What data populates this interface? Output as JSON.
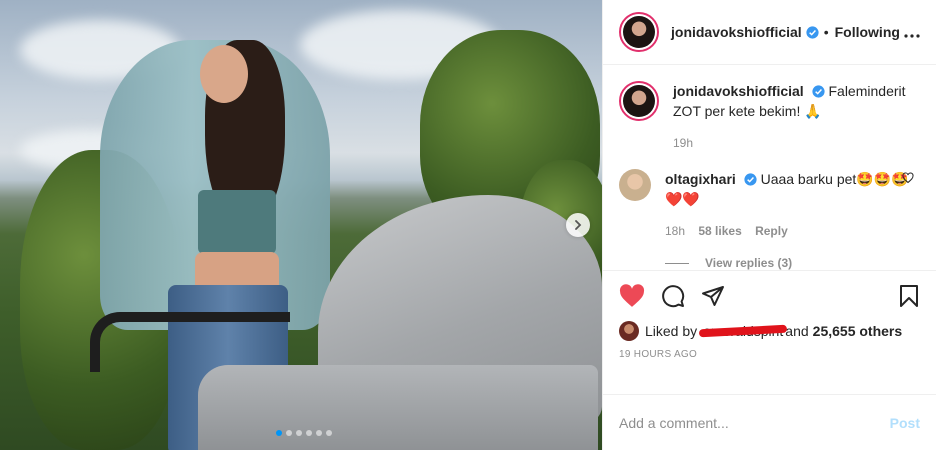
{
  "header": {
    "username": "jonidavokshiofficial",
    "separator": "•",
    "follow_state": "Following",
    "more_label": "•••"
  },
  "caption": {
    "username": "jonidavokshiofficial",
    "text": "Faleminderit ZOT per kete bekim! 🙏",
    "time": "19h"
  },
  "comments": [
    {
      "username": "oltagixhari",
      "text": "Uaaa barku pet🤩🤩🤩❤️❤️",
      "time": "18h",
      "likes": "58 likes",
      "reply_label": "Reply",
      "view_replies": "View replies (3)"
    }
  ],
  "likes": {
    "prefix": "Liked by",
    "name": "emeraldspirit",
    "suffix": "and",
    "others": "25,655 others"
  },
  "timestamp": "19 HOURS AGO",
  "add_comment": {
    "placeholder": "Add a comment...",
    "post_label": "Post"
  },
  "carousel": {
    "total_slides": 6,
    "active_index": 0
  },
  "colors": {
    "verified": "#3897f0",
    "like_red": "#ed4956",
    "post_button": "#b2dffc"
  },
  "icons": {
    "like": "heart-icon",
    "comment": "comment-icon",
    "share": "paper-plane-icon",
    "save": "bookmark-icon",
    "next": "chevron-right-icon"
  }
}
